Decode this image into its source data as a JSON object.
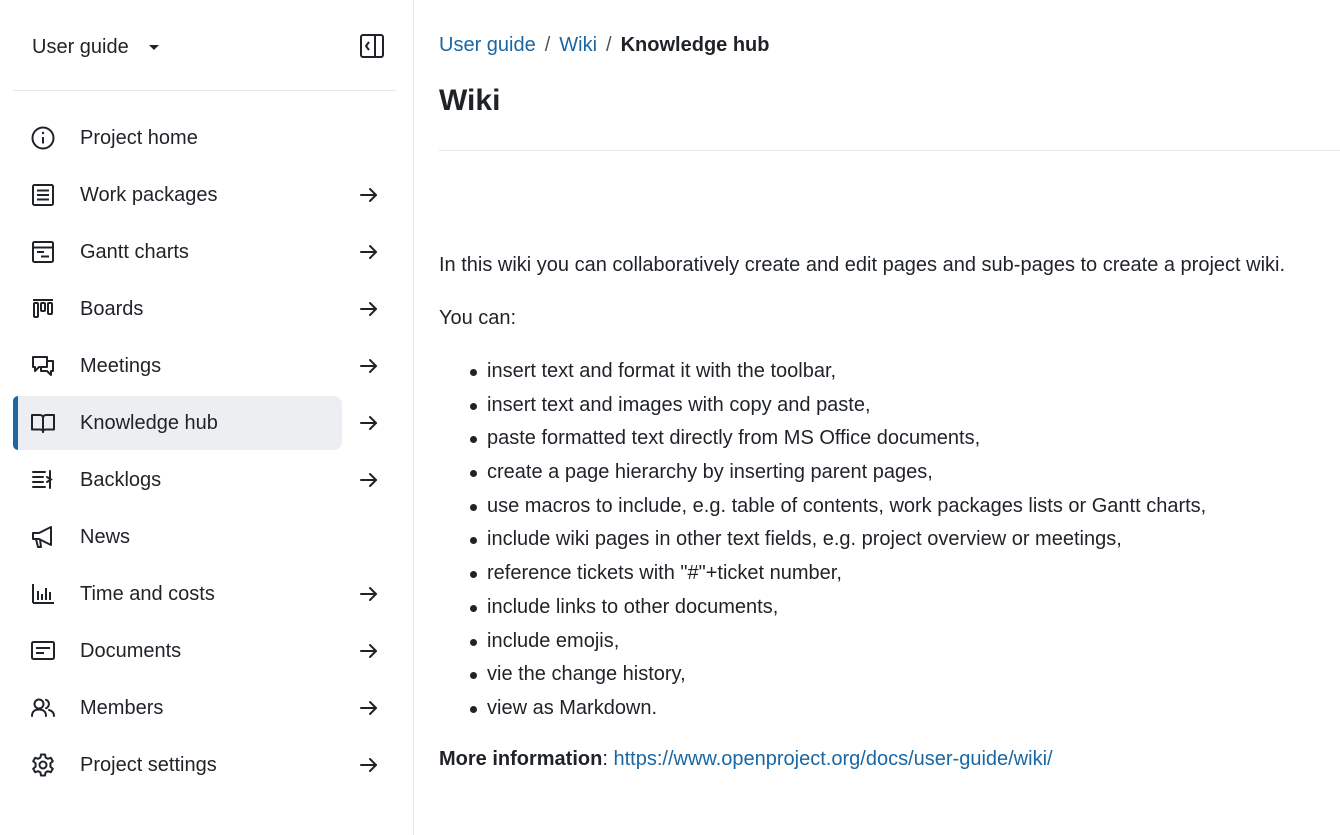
{
  "sidebar": {
    "project_name": "User guide",
    "collapse_icon": "sidebar-collapse-icon",
    "items": [
      {
        "label": "Project home",
        "icon": "info-icon",
        "arrow": false,
        "active": false
      },
      {
        "label": "Work packages",
        "icon": "list-icon",
        "arrow": true,
        "active": false
      },
      {
        "label": "Gantt charts",
        "icon": "gantt-icon",
        "arrow": true,
        "active": false
      },
      {
        "label": "Boards",
        "icon": "boards-icon",
        "arrow": true,
        "active": false
      },
      {
        "label": "Meetings",
        "icon": "meetings-icon",
        "arrow": true,
        "active": false
      },
      {
        "label": "Knowledge hub",
        "icon": "book-icon",
        "arrow": true,
        "active": true
      },
      {
        "label": "Backlogs",
        "icon": "backlogs-icon",
        "arrow": true,
        "active": false
      },
      {
        "label": "News",
        "icon": "megaphone-icon",
        "arrow": false,
        "active": false
      },
      {
        "label": "Time and costs",
        "icon": "bar-chart-icon",
        "arrow": true,
        "active": false
      },
      {
        "label": "Documents",
        "icon": "document-icon",
        "arrow": true,
        "active": false
      },
      {
        "label": "Members",
        "icon": "members-icon",
        "arrow": true,
        "active": false
      },
      {
        "label": "Project settings",
        "icon": "gear-icon",
        "arrow": true,
        "active": false
      }
    ]
  },
  "breadcrumb": {
    "items": [
      "User guide",
      "Wiki"
    ],
    "separator": "/",
    "current": "Knowledge hub"
  },
  "page": {
    "title": "Wiki",
    "intro": "In this wiki you can collaboratively create and edit pages and sub-pages to create a project wiki.",
    "you_can": "You can:",
    "bullets": [
      "insert text and format it with the toolbar,",
      "insert text and images with copy and paste,",
      "paste formatted text directly from MS Office documents,",
      "create a page hierarchy by inserting parent pages,",
      "use macros to include, e.g. table of contents, work packages lists or Gantt charts,",
      "include wiki pages in other text fields, e.g. project overview or meetings,",
      "reference tickets with \"#\"+ticket number,",
      "include links to other documents,",
      "include emojis,",
      "vie the change history,",
      "view as Markdown."
    ],
    "more_info_label": "More information",
    "more_info_colon": ": ",
    "more_info_link": "https://www.openproject.org/docs/user-guide/wiki/"
  },
  "colors": {
    "accent": "#1a67a3",
    "active_bg": "#eceef1",
    "text": "#1f2328",
    "divider": "#e3e6ea"
  }
}
